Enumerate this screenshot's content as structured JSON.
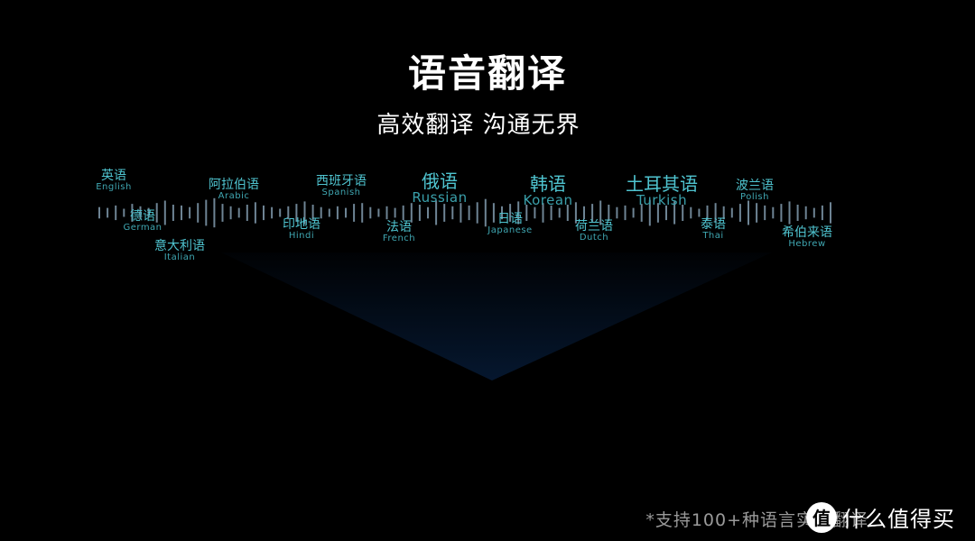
{
  "header": {
    "title": "语音翻译",
    "subtitle": "高效翻译 沟通无界"
  },
  "languages": [
    {
      "zh": "英语",
      "en": "English",
      "emphasis": false
    },
    {
      "zh": "德语",
      "en": "German",
      "emphasis": false
    },
    {
      "zh": "意大利语",
      "en": "Italian",
      "emphasis": false
    },
    {
      "zh": "阿拉伯语",
      "en": "Arabic",
      "emphasis": false
    },
    {
      "zh": "印地语",
      "en": "Hindi",
      "emphasis": false
    },
    {
      "zh": "西班牙语",
      "en": "Spanish",
      "emphasis": false
    },
    {
      "zh": "法语",
      "en": "French",
      "emphasis": false
    },
    {
      "zh": "俄语",
      "en": "Russian",
      "emphasis": true
    },
    {
      "zh": "日语",
      "en": "Japanese",
      "emphasis": false
    },
    {
      "zh": "韩语",
      "en": "Korean",
      "emphasis": true
    },
    {
      "zh": "荷兰语",
      "en": "Dutch",
      "emphasis": false
    },
    {
      "zh": "土耳其语",
      "en": "Turkish",
      "emphasis": true
    },
    {
      "zh": "泰语",
      "en": "Thai",
      "emphasis": false
    },
    {
      "zh": "波兰语",
      "en": "Polish",
      "emphasis": false
    },
    {
      "zh": "希伯来语",
      "en": "Hebrew",
      "emphasis": false
    }
  ],
  "waveform": {
    "bar_color": "#6e8494",
    "levels": [
      0.35,
      0.3,
      0.45,
      0.25,
      0.55,
      0.4,
      0.3,
      0.6,
      0.75,
      0.5,
      0.45,
      0.35,
      0.6,
      0.8,
      0.9,
      0.55,
      0.4,
      0.3,
      0.5,
      0.65,
      0.45,
      0.35,
      0.25,
      0.4,
      0.55,
      0.7,
      0.5,
      0.35,
      0.25,
      0.4,
      0.3,
      0.55,
      0.6,
      0.35,
      0.25,
      0.4,
      0.3,
      0.45,
      0.6,
      0.5,
      0.35,
      0.75,
      0.55,
      0.4,
      0.6,
      0.45,
      0.65,
      0.85,
      0.6,
      0.4,
      0.55,
      0.7,
      0.5,
      0.35,
      0.6,
      0.45,
      0.3,
      0.5,
      0.65,
      0.4,
      0.55,
      0.75,
      0.5,
      0.35,
      0.45,
      0.3,
      0.55,
      0.8,
      0.6,
      0.45,
      0.7,
      0.5,
      0.35,
      0.25,
      0.45,
      0.6,
      0.4,
      0.3,
      0.55,
      0.75,
      0.6,
      0.45,
      0.35,
      0.55,
      0.7,
      0.5,
      0.4,
      0.3,
      0.45,
      0.65
    ]
  },
  "glow_color": "#0a2a55",
  "footnote": "*支持100+种语言实时翻译",
  "watermark": {
    "badge": "值",
    "text": "什么值得买"
  }
}
